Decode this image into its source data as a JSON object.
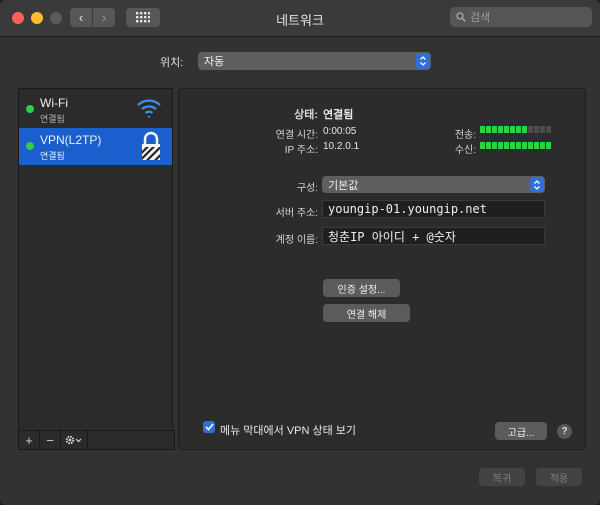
{
  "window": {
    "title": "네트워크"
  },
  "toolbar": {
    "back_label": "‹",
    "forward_label": "›"
  },
  "search": {
    "placeholder": "검색"
  },
  "location": {
    "label": "위치:",
    "value": "자동"
  },
  "services": [
    {
      "name": "Wi-Fi",
      "status": "연결됨",
      "icon": "wifi-icon"
    },
    {
      "name": "VPN(L2TP)",
      "status": "연결됨",
      "icon": "lock-icon"
    }
  ],
  "sidebar_tools": {
    "add": "+",
    "remove": "−"
  },
  "detail": {
    "status_label": "상태:",
    "status_value": "연결됨",
    "time_label": "연결 시간:",
    "time_value": "0:00:05",
    "ip_label": "IP 주소:",
    "ip_value": "10.2.0.1",
    "send_label": "전송:",
    "receive_label": "수신:",
    "send_level": 0.67,
    "receive_level": 1.0,
    "config_label": "구성:",
    "config_value": "기본값",
    "server_label": "서버 주소:",
    "server_value": "youngip-01.youngip.net",
    "account_label": "계정 이름:",
    "account_value": "청춘IP 아이디 + @숫자",
    "auth_button": "인증 설정...",
    "disconnect_button": "연결 해제",
    "menubar_checkbox_label": "메뉴 막대에서 VPN 상태 보기",
    "menubar_checkbox_checked": true,
    "advanced_button": "고급...",
    "help_label": "?"
  },
  "footer": {
    "revert_button": "복귀",
    "apply_button": "적용"
  },
  "colors": {
    "accent": "#2f6fd7",
    "selection": "#1b5fce",
    "connected": "#2fcf45"
  }
}
